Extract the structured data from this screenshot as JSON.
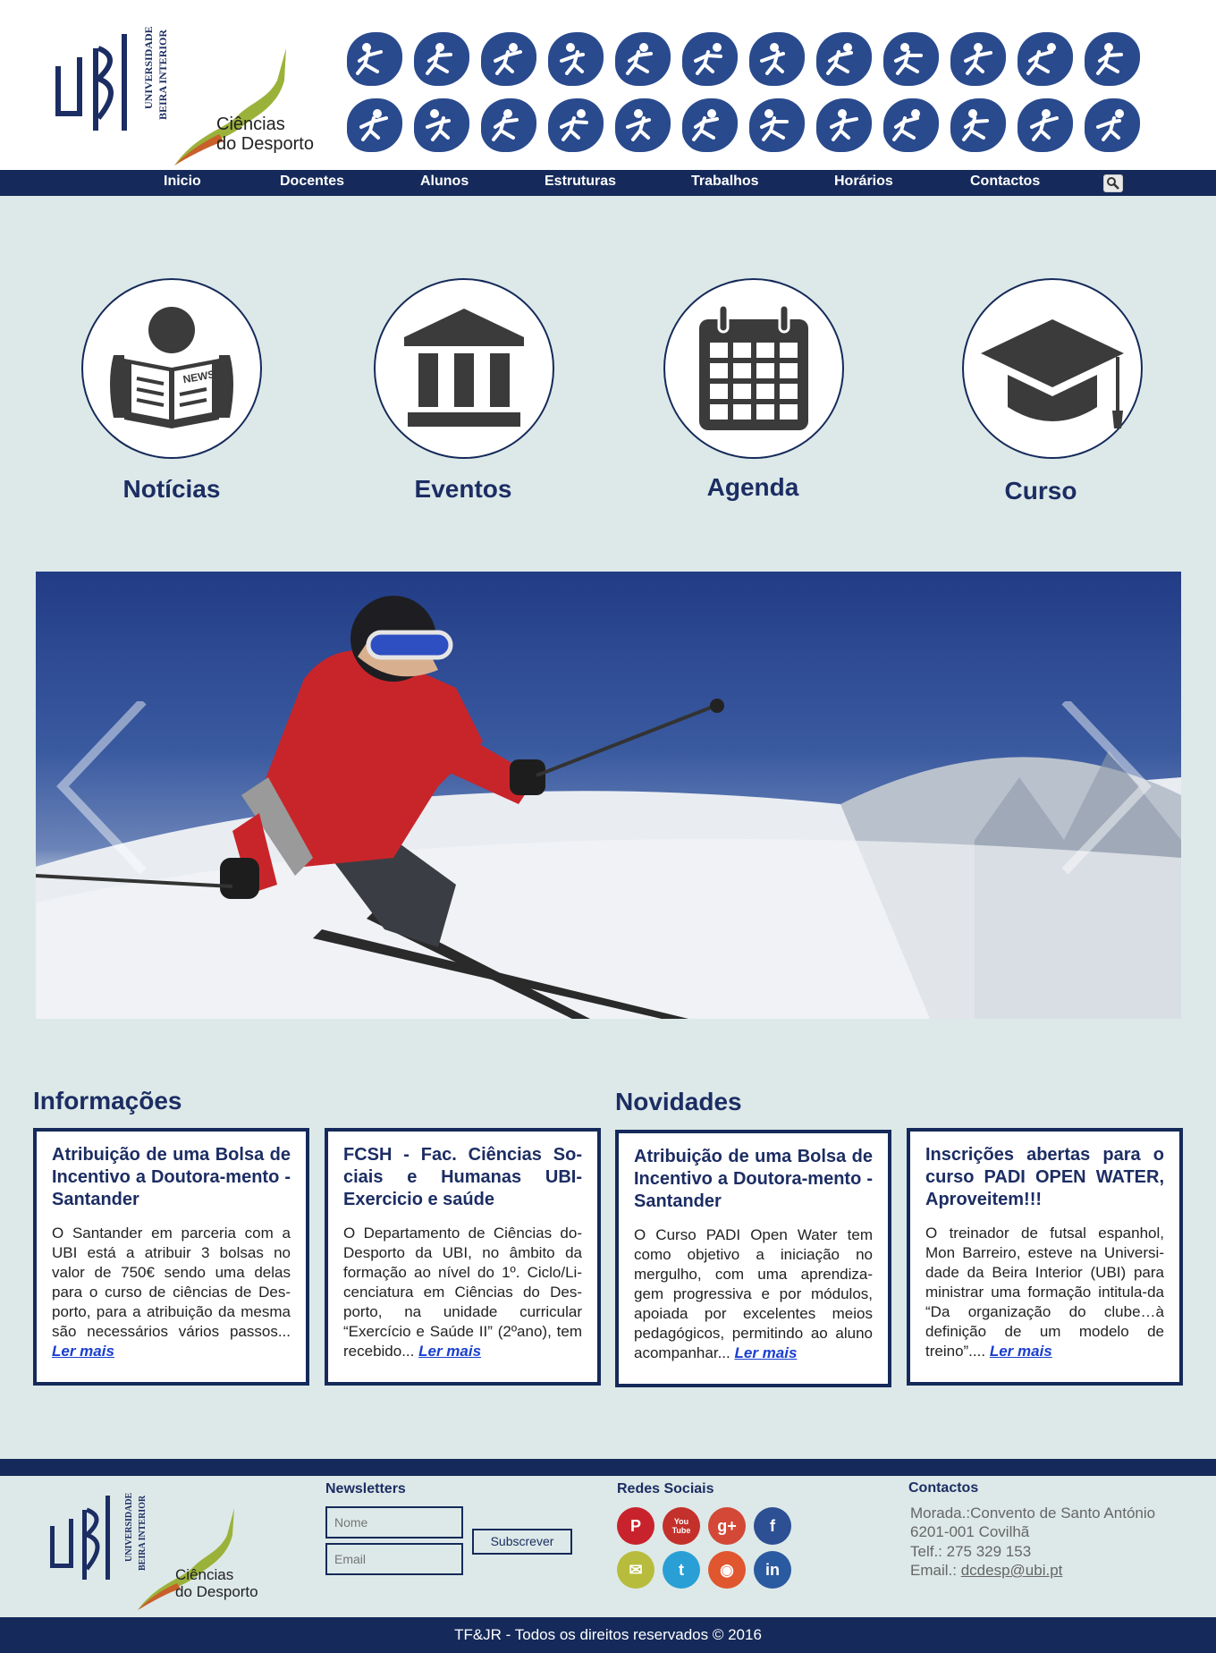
{
  "brand": {
    "university_line1": "UNIVERSIDADE",
    "university_line2": "BEIRA INTERIOR",
    "ubi_mark": "UBI",
    "course_line1": "Ciências",
    "course_line2": "do Desporto"
  },
  "sport_icons": [
    "running-icon",
    "wheelchair-tennis-icon",
    "goalball-icon",
    "wheelchair-fencing-icon",
    "athletics-icon",
    "football-icon",
    "swimming-icon",
    "table-tennis-icon",
    "wheelchair-basketball-icon",
    "rowing-icon",
    "cycling-icon",
    "shooting-icon",
    "equestrian-icon",
    "judo-icon",
    "diving-icon",
    "canoe-icon",
    "triathlon-icon",
    "road-cycling-icon",
    "paratriathlon-icon",
    "rowing-team-icon",
    "volleyball-icon",
    "golf-icon",
    "open-water-icon",
    "sailing-icon"
  ],
  "nav": {
    "items": [
      "Inicio",
      "Docentes",
      "Alunos",
      "Estruturas",
      "Trabalhos",
      "Horários",
      "Contactos"
    ]
  },
  "quick_links": [
    {
      "label": "Notícias",
      "icon": "newspaper-icon"
    },
    {
      "label": "Eventos",
      "icon": "building-icon"
    },
    {
      "label": "Agenda",
      "icon": "calendar-icon"
    },
    {
      "label": "Curso",
      "icon": "graduation-cap-icon"
    }
  ],
  "slider": {
    "image": "skier-photo",
    "prev": "chevron-left-icon",
    "next": "chevron-right-icon"
  },
  "sections": {
    "info_title": "Informações",
    "news_title": "Novidades"
  },
  "cards": [
    {
      "title": "Atribuição de uma Bolsa de Incentivo a Doutora-mento - Santander",
      "body": "O Santander em parceria com a UBI está a atribuir 3 bolsas no valor de 750€ sendo uma delas para o curso de ciências de Des-porto, para a atribuição da mesma são necessários vários passos...",
      "link": "Ler mais"
    },
    {
      "title": "FCSH - Fac. Ciências So-ciais e Humanas UBI-Exercicio e saúde",
      "body": "O Departamento de Ciências do-Desporto da UBI, no âmbito da formação ao nível do 1º. Ciclo/Li-cenciatura em Ciências do Des-porto, na unidade curricular “Exercício e Saúde II” (2ºano), tem recebido...",
      "link": "Ler mais"
    },
    {
      "title": "Atribuição de uma Bolsa de Incentivo a Doutora-mento - Santander",
      "body": "O Curso PADI Open Water tem como objetivo a iniciação no mergulho, com uma aprendiza-gem progressiva e por módulos, apoiada por excelentes meios pedagógicos, permitindo ao aluno acompanhar...",
      "link": "Ler mais"
    },
    {
      "title": "Inscrições abertas para o curso PADI OPEN WATER, Aproveitem!!!",
      "body": "O treinador de futsal espanhol, Mon Barreiro, esteve na Universi-dade da Beira Interior (UBI) para ministrar uma formação intitula-da “Da organização do clube…à definição de um modelo de treino”....",
      "link": "Ler mais"
    }
  ],
  "footer": {
    "newsletter_title": "Newsletters",
    "name_placeholder": "Nome",
    "email_placeholder": "Email",
    "subscribe": "Subscrever",
    "social_title": "Redes Sociais",
    "social": [
      {
        "name": "pinterest-icon",
        "glyph": "P",
        "color": "#c8232c"
      },
      {
        "name": "youtube-icon",
        "glyph": "You\nTube",
        "color": "#c4302b"
      },
      {
        "name": "google-plus-icon",
        "glyph": "g+",
        "color": "#d34836"
      },
      {
        "name": "facebook-icon",
        "glyph": "f",
        "color": "#2d4f94"
      },
      {
        "name": "email-icon",
        "glyph": "✉",
        "color": "#b8bc3d"
      },
      {
        "name": "twitter-icon",
        "glyph": "t",
        "color": "#2a9fd6"
      },
      {
        "name": "rss-icon",
        "glyph": "◉",
        "color": "#e0562f"
      },
      {
        "name": "linkedin-icon",
        "glyph": "in",
        "color": "#2a5aa0"
      }
    ],
    "contacts_title": "Contactos",
    "address": "Morada.:Convento de Santo António",
    "city": "6201-001 Covilhã",
    "phone": "Telf.: 275 329 153",
    "email_label": "Email.:",
    "email": "dcdesp@ubi.pt",
    "copyright": "TF&JR - Todos os direitos reservados © 2016"
  },
  "colors": {
    "navy": "#152a5a",
    "title": "#1c2d63",
    "background": "#dde9e8",
    "link": "#1a3fcf",
    "sport_icon": "#2a4a8e"
  }
}
